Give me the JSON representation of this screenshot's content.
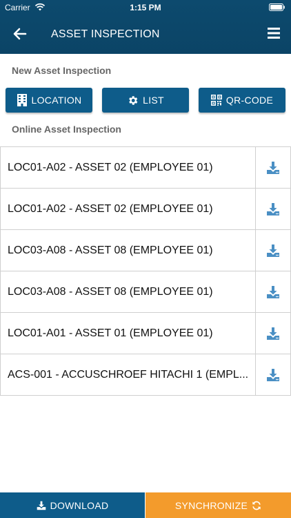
{
  "status_bar": {
    "carrier": "Carrier",
    "time": "1:15 PM"
  },
  "nav": {
    "title": "ASSET INSPECTION",
    "back_icon": "arrow-left-icon",
    "menu_icon": "hamburger-menu-icon"
  },
  "new_section": {
    "label": "New Asset Inspection",
    "buttons": [
      {
        "label": "LOCATION",
        "icon": "building-icon"
      },
      {
        "label": "LIST",
        "icon": "gear-icon"
      },
      {
        "label": "QR-CODE",
        "icon": "qrcode-icon"
      }
    ]
  },
  "online_section": {
    "label": "Online Asset Inspection",
    "items": [
      {
        "label": "LOC01-A02 - ASSET 02 (EMPLOYEE 01)"
      },
      {
        "label": "LOC01-A02 - ASSET 02 (EMPLOYEE 01)"
      },
      {
        "label": "LOC03-A08 - ASSET 08 (EMPLOYEE 01)"
      },
      {
        "label": "LOC03-A08 - ASSET 08 (EMPLOYEE 01)"
      },
      {
        "label": "LOC01-A01 - ASSET 01 (EMPLOYEE 01)"
      },
      {
        "label": "ACS-001 - ACCUSCHROEF HITACHI 1 (EMPL..."
      }
    ],
    "row_icon": "download-tray-icon"
  },
  "bottom": {
    "download_label": "DOWNLOAD",
    "sync_label": "SYNCHRONIZE"
  },
  "colors": {
    "header": "#0b4466",
    "primary": "#0e5c8a",
    "accent": "#f39b2c",
    "download_icon": "#4a8fc4"
  }
}
